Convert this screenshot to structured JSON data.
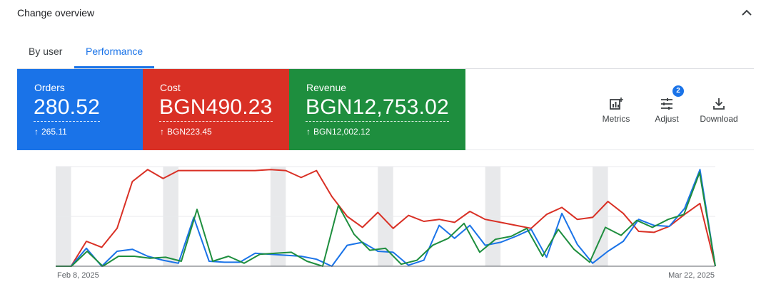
{
  "header": {
    "title": "Change overview"
  },
  "tabs": [
    {
      "label": "By user"
    },
    {
      "label": "Performance"
    }
  ],
  "cards": [
    {
      "label": "Orders",
      "value": "280.52",
      "delta": "265.11",
      "color": "#1a73e8"
    },
    {
      "label": "Cost",
      "value": "BGN490.23",
      "delta": "BGN223.45",
      "color": "#d93025"
    },
    {
      "label": "Revenue",
      "value": "BGN12,753.02",
      "delta": "BGN12,002.12",
      "color": "#1e8e3e"
    }
  ],
  "toolbar": {
    "metrics_label": "Metrics",
    "adjust_label": "Adjust",
    "adjust_badge": "2",
    "download_label": "Download"
  },
  "chart_data": {
    "type": "line",
    "x_start_label": "Feb 8, 2025",
    "x_end_label": "Mar 22, 2025",
    "series": [
      {
        "color": "#d93025",
        "values": [
          0,
          0,
          25,
          19,
          38,
          85,
          97,
          88,
          96,
          96,
          96,
          96,
          96,
          96,
          97,
          96,
          89,
          96,
          70,
          50,
          39,
          54,
          38,
          51,
          45,
          47,
          44,
          55,
          47,
          44,
          41,
          38,
          52,
          59,
          47,
          49,
          65,
          53,
          35,
          34,
          40,
          52,
          63,
          0
        ]
      },
      {
        "color": "#1a73e8",
        "values": [
          0,
          0,
          18,
          0,
          15,
          17,
          10,
          6,
          3,
          49,
          5,
          4,
          4,
          13,
          12,
          11,
          10,
          7,
          0,
          21,
          24,
          15,
          14,
          1,
          6,
          41,
          28,
          41,
          21,
          24,
          30,
          37,
          9,
          53,
          22,
          3,
          15,
          25,
          47,
          41,
          40,
          58,
          97,
          0
        ]
      },
      {
        "color": "#1e8e3e",
        "values": [
          0,
          0,
          15,
          0,
          10,
          10,
          8,
          9,
          5,
          57,
          5,
          10,
          3,
          12,
          13,
          14,
          5,
          0,
          61,
          32,
          16,
          18,
          2,
          6,
          21,
          28,
          43,
          14,
          27,
          30,
          38,
          10,
          37,
          17,
          4,
          39,
          31,
          46,
          39,
          47,
          52,
          94,
          0
        ]
      }
    ]
  }
}
